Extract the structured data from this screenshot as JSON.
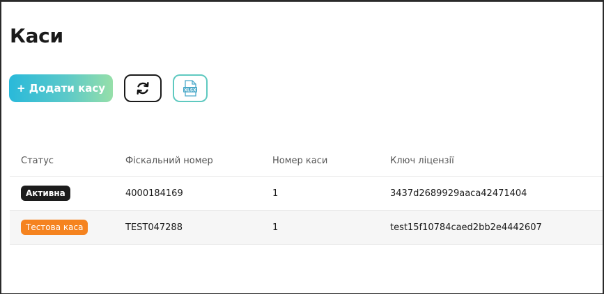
{
  "page": {
    "title": "Каси"
  },
  "toolbar": {
    "add_label": "+ Додати касу",
    "refresh_icon": "refresh-icon",
    "xlsx_icon": "xlsx-file-icon",
    "xlsx_icon_text": "XLSX"
  },
  "table": {
    "columns": [
      "Статус",
      "Фіскальний номер",
      "Номер каси",
      "Ключ ліцензії"
    ],
    "rows": [
      {
        "status": "Активна",
        "status_color": "#1c1c1c",
        "fiscal_number": "4000184169",
        "register_number": "1",
        "license_key": "3437d2689929aaca42471404"
      },
      {
        "status": "Тестова каса",
        "status_color": "#f5831f",
        "fiscal_number": "TEST047288",
        "register_number": "1",
        "license_key": "test15f10784caed2bb2e4442607"
      }
    ]
  },
  "colors": {
    "accent_gradient_start": "#29b9da",
    "accent_gradient_end": "#96dfa9",
    "xlsx_border": "#5fc9c0"
  }
}
